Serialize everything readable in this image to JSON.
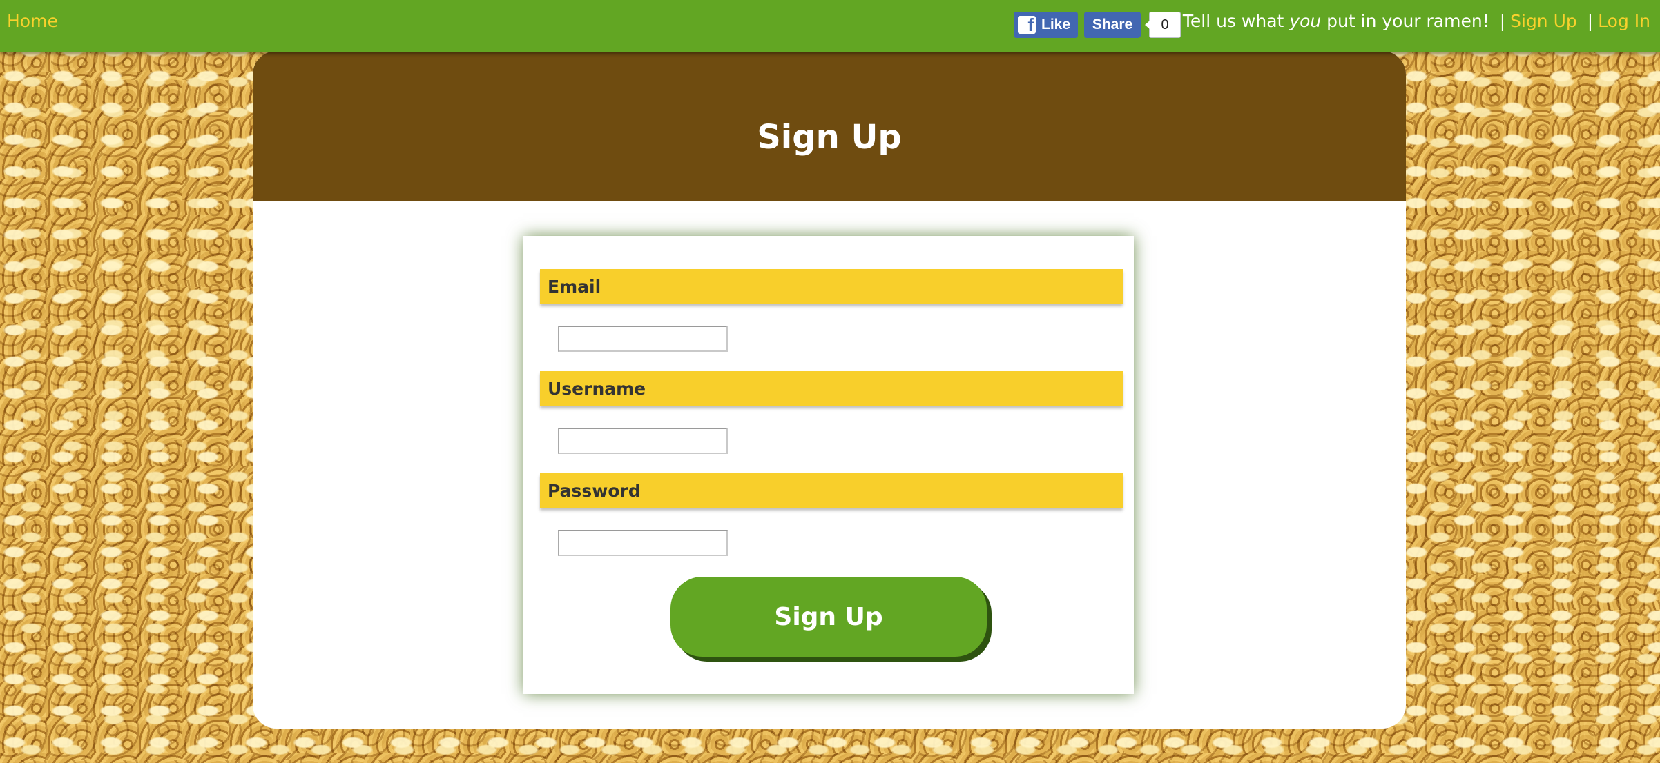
{
  "nav": {
    "home_label": "Home",
    "facebook": {
      "like_label": "Like",
      "share_label": "Share",
      "share_count": "0"
    },
    "tagline_before": "Tell us what ",
    "tagline_emphasis": "you",
    "tagline_after": " put in your ramen!",
    "separator": "|",
    "signup_label": "Sign Up",
    "login_label": "Log In"
  },
  "page": {
    "title": "Sign Up"
  },
  "form": {
    "fields": [
      {
        "label": "Email",
        "value": ""
      },
      {
        "label": "Username",
        "value": ""
      },
      {
        "label": "Password",
        "value": ""
      }
    ],
    "submit_label": "Sign Up"
  },
  "colors": {
    "nav_bar": "#62a623",
    "link": "#f9d12d",
    "header_brown": "#6f4c10",
    "label_yellow": "#f8cf2b",
    "button_green": "#62a623",
    "button_shadow": "#2e5310",
    "facebook_blue": "#4267b2"
  },
  "icons": [
    "facebook-icon"
  ]
}
